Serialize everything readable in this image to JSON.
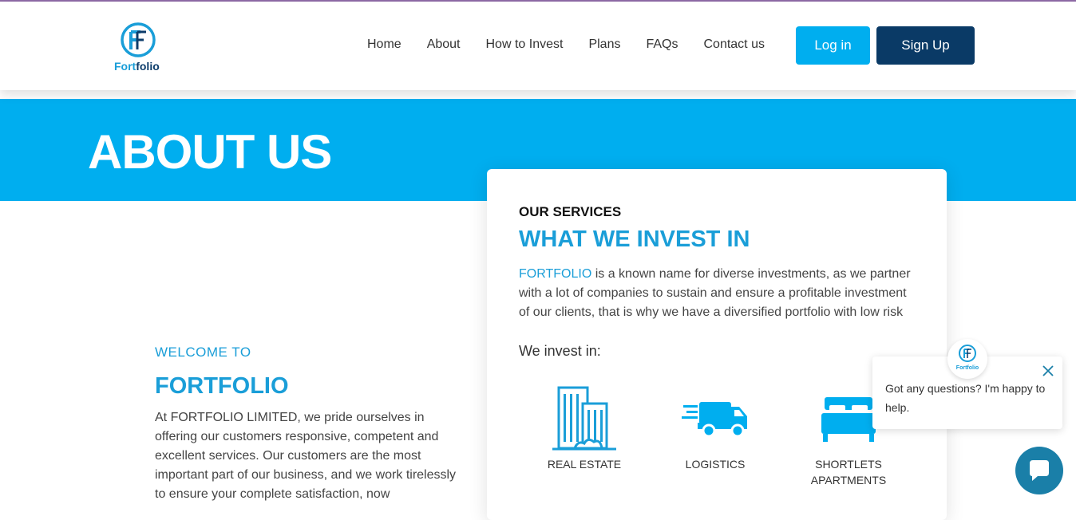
{
  "brand": {
    "logo_text_1": "Fort",
    "logo_text_2": "folio",
    "logo_mini": "Fortfolio"
  },
  "nav": {
    "items": [
      "Home",
      "About",
      "How to Invest",
      "Plans",
      "FAQs",
      "Contact us"
    ]
  },
  "auth": {
    "login_label": "Log in",
    "signup_label": "Sign Up"
  },
  "hero": {
    "title": "ABOUT US"
  },
  "welcome": {
    "kicker": "WELCOME TO",
    "name": "FORTFOLIO",
    "text": "At FORTFOLIO LIMITED, we pride ourselves in offering our customers responsive, competent and excellent services. Our customers are the most important part of our business, and we work tirelessly to ensure your complete satisfaction, now"
  },
  "services": {
    "kicker": "OUR SERVICES",
    "title": "WHAT WE INVEST IN",
    "desc_highlight": "FORTFOLIO",
    "desc_rest": " is a known name for diverse investments, as we partner with a lot of companies to sustain and ensure a profitable investment of our clients, that is why we have a diversified portfolio with low risk",
    "invest_in": "We invest in:",
    "items": [
      {
        "label": "REAL ESTATE",
        "icon": "buildings-icon"
      },
      {
        "label": "LOGISTICS",
        "icon": "truck-icon"
      },
      {
        "label": "SHORTLETS APARTMENTS",
        "icon": "bed-icon"
      }
    ]
  },
  "chat": {
    "message": "Got any questions? I'm happy to help."
  },
  "colors": {
    "accent": "#00aeef",
    "navy": "#0a3a66",
    "text_blue": "#1a9ed8",
    "chat": "#1a7fa8"
  }
}
